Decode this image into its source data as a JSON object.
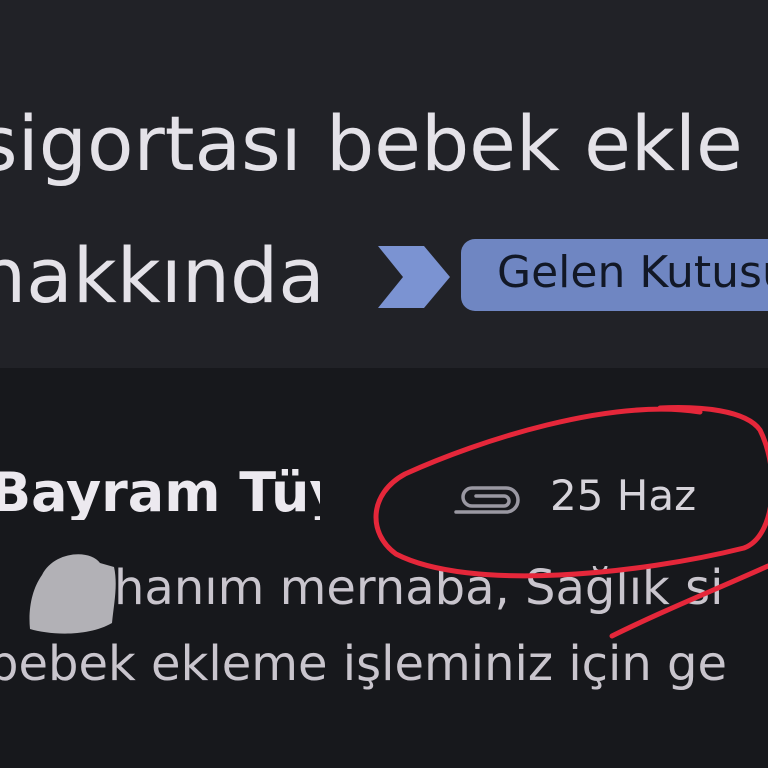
{
  "subject": {
    "line1": "sigortası bebek ekle",
    "line2": "nakkında"
  },
  "label_chip": {
    "text": "Gelen Kutusu"
  },
  "message": {
    "sender": "Bayram Tüy",
    "date": "25 Haz",
    "snippet_line1": "hanım mernaba, Sağlık si",
    "snippet_line2": "bebek ekleme işleminiz için ge"
  },
  "icons": {
    "importance": "importance-arrow-icon",
    "attachment": "paperclip-icon"
  },
  "colors": {
    "header_background": "#212227",
    "message_background": "#17181c",
    "chip_background": "#6f86c2",
    "importance_marker": "#7b93d2",
    "annotation": "#e5273a"
  }
}
